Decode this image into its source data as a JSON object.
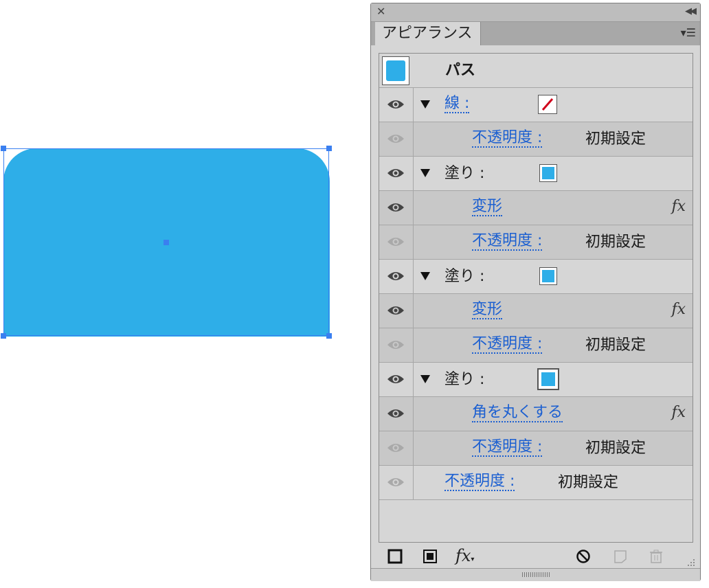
{
  "panel": {
    "title": "アピアランス",
    "object_label": "パス"
  },
  "colors": {
    "fill": "#2eaee8",
    "selection": "#3a7ff0",
    "link": "#1b5fd1",
    "stroke_none": "#d0021b"
  },
  "rows": [
    {
      "label": "線 :",
      "type": "stroke",
      "eye": "on"
    },
    {
      "label": "不透明度 :",
      "value": "初期設定",
      "eye": "dim"
    },
    {
      "label": "塗り :",
      "type": "fill",
      "eye": "on"
    },
    {
      "label": "変形",
      "fx": "fx",
      "eye": "on"
    },
    {
      "label": "不透明度 :",
      "value": "初期設定",
      "eye": "dim"
    },
    {
      "label": "塗り :",
      "type": "fill",
      "eye": "on"
    },
    {
      "label": "変形",
      "fx": "fx",
      "eye": "on"
    },
    {
      "label": "不透明度 :",
      "value": "初期設定",
      "eye": "dim"
    },
    {
      "label": "塗り :",
      "type": "fill",
      "eye": "on"
    },
    {
      "label": "角を丸くする",
      "fx": "fx",
      "eye": "on"
    },
    {
      "label": "不透明度 :",
      "value": "初期設定",
      "eye": "dim"
    },
    {
      "label": "不透明度 :",
      "value": "初期設定",
      "eye": "dim"
    }
  ],
  "footer": {
    "fx_label": "fx"
  }
}
